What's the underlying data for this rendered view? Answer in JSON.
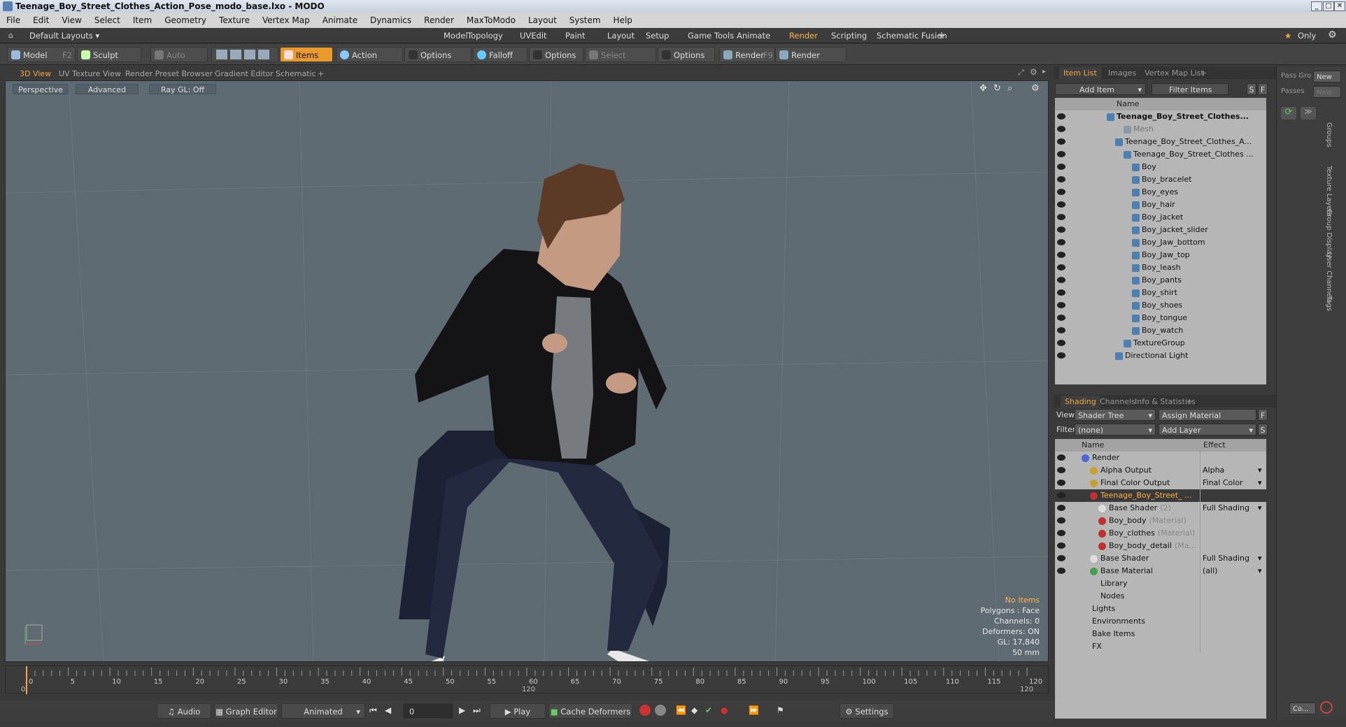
{
  "window": {
    "title": "Teenage_Boy_Street_Clothes_Action_Pose_modo_base.lxo - MODO"
  },
  "menu": [
    "File",
    "Edit",
    "View",
    "Select",
    "Item",
    "Geometry",
    "Texture",
    "Vertex Map",
    "Animate",
    "Dynamics",
    "Render",
    "MaxToModo",
    "Layout",
    "System",
    "Help"
  ],
  "layout_bar": {
    "layout_select": "Default Layouts ▾",
    "tabs": [
      "Model",
      "Topology",
      "UVEdit",
      "Paint",
      "Layout",
      "Setup",
      "Game Tools",
      "Animate",
      "Render",
      "Scripting",
      "Schematic Fusion"
    ],
    "active_tab": "Render",
    "add": "+",
    "only": "Only"
  },
  "toolbar": {
    "model": "Model",
    "model_key": "F2",
    "sculpt": "Sculpt",
    "auto_select": "Auto Select",
    "items": "Items",
    "action_center": "Action Center",
    "options1": "Options",
    "falloff": "Falloff",
    "options2": "Options",
    "select_through": "Select Through",
    "options3": "Options",
    "render": "Render",
    "render_key": "F9",
    "render_window": "Render Window"
  },
  "view_tabs": [
    "3D View",
    "UV Texture View",
    "Render Preset Browser",
    "Gradient Editor",
    "Schematic",
    "+"
  ],
  "viewport": {
    "perspective": "Perspective",
    "advanced": "Advanced",
    "raygl": "Ray GL: Off",
    "stats": [
      "No Items",
      "Polygons : Face",
      "Channels: 0",
      "Deformers: ON",
      "GL: 17,840",
      "50 mm"
    ]
  },
  "timeline": {
    "ticks": [
      "0",
      "5",
      "10",
      "15",
      "20",
      "25",
      "30",
      "35",
      "40",
      "45",
      "50",
      "55",
      "60",
      "65",
      "70",
      "75",
      "80",
      "85",
      "90",
      "95",
      "100",
      "105",
      "110",
      "115",
      "120"
    ],
    "start": "0",
    "mid": "120",
    "end": "120"
  },
  "bottom": {
    "audio": "Audio",
    "graph_editor": "Graph Editor",
    "animated": "Animated",
    "frame": "0",
    "play": "Play",
    "cache_deformers": "Cache Deformers",
    "settings": "Settings"
  },
  "item_panel": {
    "tabs": [
      "Item List",
      "Images",
      "Vertex Map List",
      "+"
    ],
    "add_item": "Add Item",
    "filter_items": "Filter Items",
    "s": "S",
    "f": "F",
    "name_header": "Name",
    "items": [
      {
        "label": "Teenage_Boy_Street_Clothes...",
        "indent": 0,
        "bold": true
      },
      {
        "label": "Mesh",
        "indent": 2,
        "dim": true
      },
      {
        "label": "Teenage_Boy_Street_Clothes_A...",
        "indent": 1
      },
      {
        "label": "Teenage_Boy_Street_Clothes ...",
        "indent": 2
      },
      {
        "label": "Boy",
        "indent": 3
      },
      {
        "label": "Boy_bracelet",
        "indent": 3
      },
      {
        "label": "Boy_eyes",
        "indent": 3
      },
      {
        "label": "Boy_hair",
        "indent": 3
      },
      {
        "label": "Boy_jacket",
        "indent": 3
      },
      {
        "label": "Boy_jacket_slider",
        "indent": 3
      },
      {
        "label": "Boy_Jaw_bottom",
        "indent": 3
      },
      {
        "label": "Boy_Jaw_top",
        "indent": 3
      },
      {
        "label": "Boy_leash",
        "indent": 3
      },
      {
        "label": "Boy_pants",
        "indent": 3
      },
      {
        "label": "Boy_shirt",
        "indent": 3
      },
      {
        "label": "Boy_shoes",
        "indent": 3
      },
      {
        "label": "Boy_tongue",
        "indent": 3
      },
      {
        "label": "Boy_watch",
        "indent": 3
      },
      {
        "label": "TextureGroup",
        "indent": 2
      },
      {
        "label": "Directional Light",
        "indent": 1
      }
    ]
  },
  "shading_panel": {
    "tabs": [
      "Shading",
      "Channels",
      "Info & Statistics",
      "+"
    ],
    "view_label": "View",
    "view_value": "Shader Tree",
    "assign_material": "Assign Material",
    "f": "F",
    "filter_label": "Filter",
    "filter_value": "(none)",
    "add_layer": "Add Layer",
    "s": "S",
    "name_header": "Name",
    "effect_header": "Effect",
    "rows": [
      {
        "label": "Render",
        "sub": "",
        "effect": "",
        "indent": 0,
        "color": "#4a66d8"
      },
      {
        "label": "Alpha Output",
        "sub": "",
        "effect": "Alpha",
        "indent": 1,
        "color": "#c8a030"
      },
      {
        "label": "Final Color Output",
        "sub": "",
        "effect": "Final Color",
        "indent": 1,
        "color": "#c8a030"
      },
      {
        "label": "Teenage_Boy_Street_ ...",
        "sub": "",
        "effect": "",
        "indent": 1,
        "color": "#c03030",
        "selected": true
      },
      {
        "label": "Base Shader",
        "sub": "(2)",
        "effect": "Full Shading",
        "indent": 2,
        "color": "#dddddd"
      },
      {
        "label": "Boy_body",
        "sub": "(Material)",
        "effect": "",
        "indent": 2,
        "color": "#c03030"
      },
      {
        "label": "Boy_clothes",
        "sub": "(Material)",
        "effect": "",
        "indent": 2,
        "color": "#c03030"
      },
      {
        "label": "Boy_body_detail",
        "sub": "(Ma...",
        "effect": "",
        "indent": 2,
        "color": "#c03030"
      },
      {
        "label": "Base Shader",
        "sub": "",
        "effect": "Full Shading",
        "indent": 1,
        "color": "#dddddd"
      },
      {
        "label": "Base Material",
        "sub": "",
        "effect": "(all)",
        "indent": 1,
        "color": "#40a050"
      },
      {
        "label": "Library",
        "sub": "",
        "effect": "",
        "indent": 1,
        "noeye": true
      },
      {
        "label": "Nodes",
        "sub": "",
        "effect": "",
        "indent": 1,
        "noeye": true
      },
      {
        "label": "Lights",
        "sub": "",
        "effect": "",
        "indent": 0,
        "noeye": true
      },
      {
        "label": "Environments",
        "sub": "",
        "effect": "",
        "indent": 0,
        "noeye": true
      },
      {
        "label": "Bake Items",
        "sub": "",
        "effect": "",
        "indent": 0,
        "noeye": true
      },
      {
        "label": "FX",
        "sub": "",
        "effect": "",
        "indent": 0,
        "noeye": true
      }
    ]
  },
  "far_right": {
    "pass_groups": "Pass Gro",
    "passes": "Passes",
    "new1": "New",
    "new2": "New",
    "vertical_tabs": [
      "Groups",
      "Texture Layers",
      "Group Display",
      "User Channels",
      "Tags"
    ],
    "command": "Co..."
  }
}
